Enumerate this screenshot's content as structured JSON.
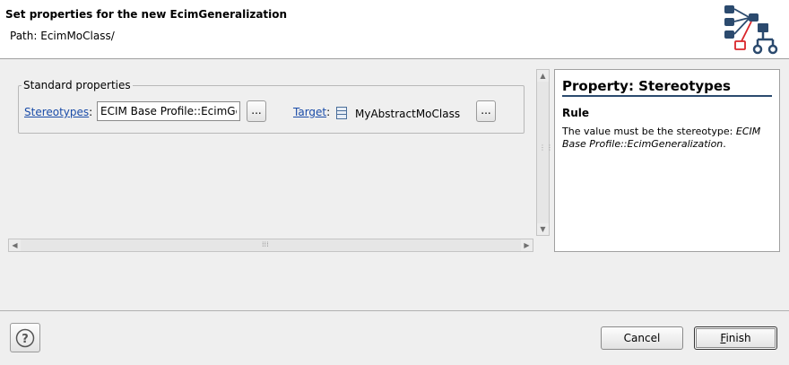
{
  "header": {
    "title": "Set properties for the new EcimGeneralization",
    "path_label": "Path:",
    "path_value": "EcimMoClass/"
  },
  "standard_properties": {
    "legend": "Standard properties",
    "stereotypes_label": "Stereotypes",
    "stereotypes_value": "ECIM Base Profile::EcimGeneralization",
    "browse_label": "...",
    "target_label": "Target",
    "target_value": "MyAbstractMoClass",
    "colon": ":"
  },
  "property_panel": {
    "title": "Property: Stereotypes",
    "rule_heading": "Rule",
    "desc_prefix": "The value must be the stereotype: ",
    "desc_value": "ECIM Base Profile::EcimGeneralization",
    "desc_suffix": "."
  },
  "footer": {
    "help_label": "?",
    "cancel_label": "Cancel",
    "finish_mnemonic": "F",
    "finish_rest": "inish"
  },
  "colors": {
    "link": "#1a4ca8",
    "logo_blue": "#2b4a6e",
    "logo_red": "#d9252a",
    "title_underline": "#2b4a6e"
  }
}
